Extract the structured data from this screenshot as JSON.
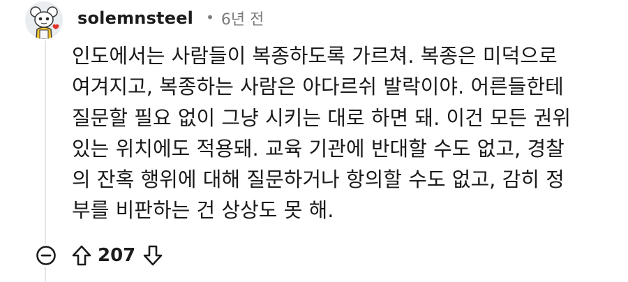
{
  "comment": {
    "author": "solemnsteel",
    "separator": "•",
    "time_ago": "6년 전",
    "lines": [
      "인도에서는 사람들이 복종하도록 가르쳐. 복종은 미덕으로",
      "여겨지고, 복종하는 사람은 아다르쉬 발락이야. 어른들한테",
      "질문할 필요 없이 그냥 시키는 대로 하면 돼. 이건 모든 권위",
      "있는 위치에도 적용돼. 교육 기관에 반대할 수도 없고, 경찰",
      "의 잔혹 행위에 대해 질문하거나 항의할 수도 없고, 감히 정",
      "부를 비판하는 건 상상도 못 해."
    ],
    "score": "207"
  },
  "icons": {
    "avatar": "snoo-avatar",
    "collapse": "minus-circle-icon",
    "upvote": "arrow-up-icon",
    "downvote": "arrow-down-icon"
  },
  "colors": {
    "text": "#1a1a1b",
    "meta": "#7c7c7c",
    "thread_line": "#e3e6e8"
  }
}
